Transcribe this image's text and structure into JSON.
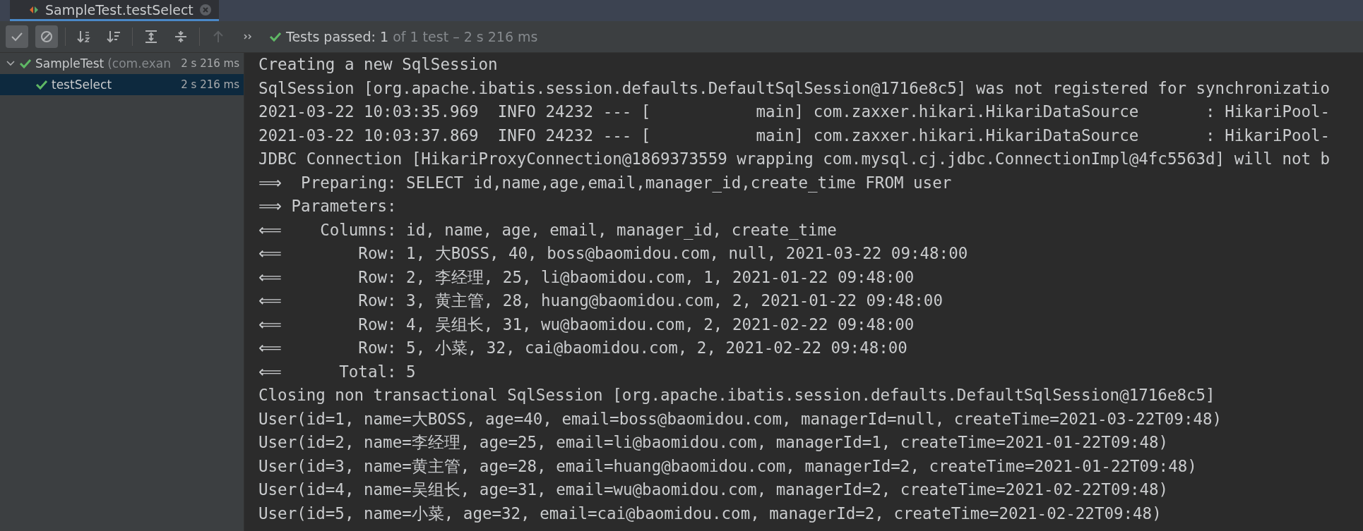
{
  "tab": {
    "title": "SampleTest.testSelect",
    "selected": true
  },
  "toolbar": {
    "buttons": [
      {
        "kind": "check",
        "on": true,
        "disabled": false
      },
      {
        "kind": "ignored",
        "on": true,
        "disabled": false
      },
      {
        "kind": "sort-alpha",
        "on": false,
        "disabled": false
      },
      {
        "kind": "sort-duration",
        "on": false,
        "disabled": false
      },
      {
        "kind": "expand",
        "on": false,
        "disabled": false
      },
      {
        "kind": "collapse",
        "on": false,
        "disabled": false
      },
      {
        "kind": "up",
        "on": false,
        "disabled": true
      },
      {
        "kind": "more",
        "on": false,
        "disabled": false
      }
    ],
    "status": "Tests passed: 1",
    "status_detail": "of 1 test – 2 s 216 ms"
  },
  "tree": [
    {
      "name": "SampleTest",
      "detail": "(com.exan",
      "time": "2 s 216 ms",
      "passed": true,
      "expanded": true,
      "selected": false,
      "children": [
        {
          "name": "testSelect",
          "time": "2 s 216 ms",
          "passed": true,
          "selected": true
        }
      ]
    }
  ],
  "console": [
    "Creating a new SqlSession",
    "SqlSession [org.apache.ibatis.session.defaults.DefaultSqlSession@1716e8c5] was not registered for synchronizatio",
    "2021-03-22 10:03:35.969  INFO 24232 --- [           main] com.zaxxer.hikari.HikariDataSource       : HikariPool-",
    "2021-03-22 10:03:37.869  INFO 24232 --- [           main] com.zaxxer.hikari.HikariDataSource       : HikariPool-",
    "JDBC Connection [HikariProxyConnection@1869373559 wrapping com.mysql.cj.jdbc.ConnectionImpl@4fc5563d] will not b",
    "⟹  Preparing: SELECT id,name,age,email,manager_id,create_time FROM user",
    "⟹ Parameters: ",
    "⟸    Columns: id, name, age, email, manager_id, create_time",
    "⟸        Row: 1, 大BOSS, 40, boss@baomidou.com, null, 2021-03-22 09:48:00",
    "⟸        Row: 2, 李经理, 25, li@baomidou.com, 1, 2021-01-22 09:48:00",
    "⟸        Row: 3, 黄主管, 28, huang@baomidou.com, 2, 2021-01-22 09:48:00",
    "⟸        Row: 4, 吴组长, 31, wu@baomidou.com, 2, 2021-02-22 09:48:00",
    "⟸        Row: 5, 小菜, 32, cai@baomidou.com, 2, 2021-02-22 09:48:00",
    "⟸      Total: 5",
    "Closing non transactional SqlSession [org.apache.ibatis.session.defaults.DefaultSqlSession@1716e8c5]",
    "User(id=1, name=大BOSS, age=40, email=boss@baomidou.com, managerId=null, createTime=2021-03-22T09:48)",
    "User(id=2, name=李经理, age=25, email=li@baomidou.com, managerId=1, createTime=2021-01-22T09:48)",
    "User(id=3, name=黄主管, age=28, email=huang@baomidou.com, managerId=2, createTime=2021-01-22T09:48)",
    "User(id=4, name=吴组长, age=31, email=wu@baomidou.com, managerId=2, createTime=2021-02-22T09:48)",
    "User(id=5, name=小菜, age=32, email=cai@baomidou.com, managerId=2, createTime=2021-02-22T09:48)"
  ]
}
